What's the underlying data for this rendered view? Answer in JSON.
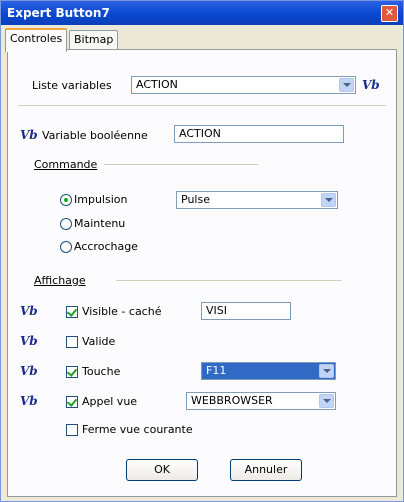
{
  "window": {
    "title": "Expert Button7",
    "close_glyph": "✕"
  },
  "tabs": [
    {
      "label": "Controles",
      "active": true
    },
    {
      "label": "Bitmap",
      "active": false
    }
  ],
  "vb_label": "Vb",
  "liste_variables": {
    "label": "Liste variables",
    "value": "ACTION"
  },
  "variable_booleenne": {
    "label": "Variable booléenne",
    "value": "ACTION"
  },
  "commande": {
    "heading": "Commande",
    "options": [
      {
        "label": "Impulsion",
        "selected": true
      },
      {
        "label": "Maintenu",
        "selected": false
      },
      {
        "label": "Accrochage",
        "selected": false
      }
    ],
    "impulsion_select": "Pulse"
  },
  "affichage": {
    "heading": "Affichage",
    "visible_cache": {
      "label": "Visible - caché",
      "checked": true,
      "value": "VISI"
    },
    "valide": {
      "label": "Valide",
      "checked": false
    },
    "touche": {
      "label": "Touche",
      "checked": true,
      "value": "F11"
    },
    "appel_vue": {
      "label": "Appel vue",
      "checked": true,
      "value": "WEBBROWSER"
    },
    "ferme_vue": {
      "label": "Ferme vue courante",
      "checked": false
    }
  },
  "buttons": {
    "ok": "OK",
    "annuler": "Annuler"
  },
  "colors": {
    "title_bar": "#0a48d0",
    "vb": "#1c2c8c",
    "touche_highlight": "#316ac5",
    "tab_accent": "#f1a440"
  }
}
